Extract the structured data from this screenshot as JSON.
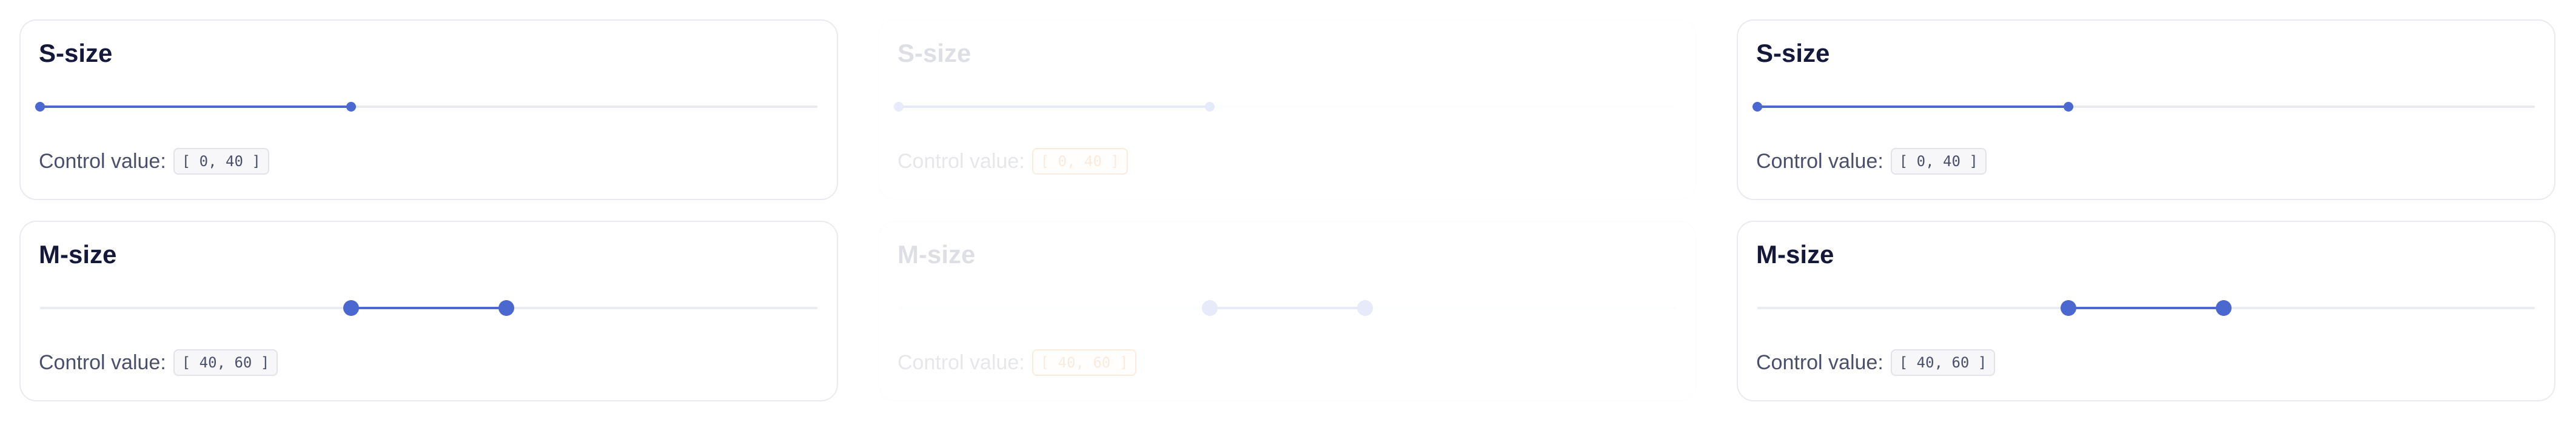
{
  "panels": [
    {
      "state": "normal",
      "cards": [
        {
          "title": "S-size",
          "size": "s",
          "value": [
            0,
            40
          ],
          "control_label": "Control value:",
          "control_code": "[ 0, 40 ]"
        },
        {
          "title": "M-size",
          "size": "m",
          "value": [
            40,
            60
          ],
          "control_label": "Control value:",
          "control_code": "[ 40, 60 ]"
        }
      ]
    },
    {
      "state": "disabled",
      "cards": [
        {
          "title": "S-size",
          "size": "s",
          "value": [
            0,
            40
          ],
          "control_label": "Control value:",
          "control_code": "[ 0, 40 ]"
        },
        {
          "title": "M-size",
          "size": "m",
          "value": [
            40,
            60
          ],
          "control_label": "Control value:",
          "control_code": "[ 40, 60 ]"
        }
      ]
    },
    {
      "state": "normal",
      "cards": [
        {
          "title": "S-size",
          "size": "s",
          "value": [
            0,
            40
          ],
          "control_label": "Control value:",
          "control_code": "[ 0, 40 ]"
        },
        {
          "title": "M-size",
          "size": "m",
          "value": [
            40,
            60
          ],
          "control_label": "Control value:",
          "control_code": "[ 40, 60 ]"
        }
      ]
    }
  ],
  "colors": {
    "accent": "#4a68d0",
    "track": "#e9ebf0",
    "disabled_code": "#e06f00"
  }
}
